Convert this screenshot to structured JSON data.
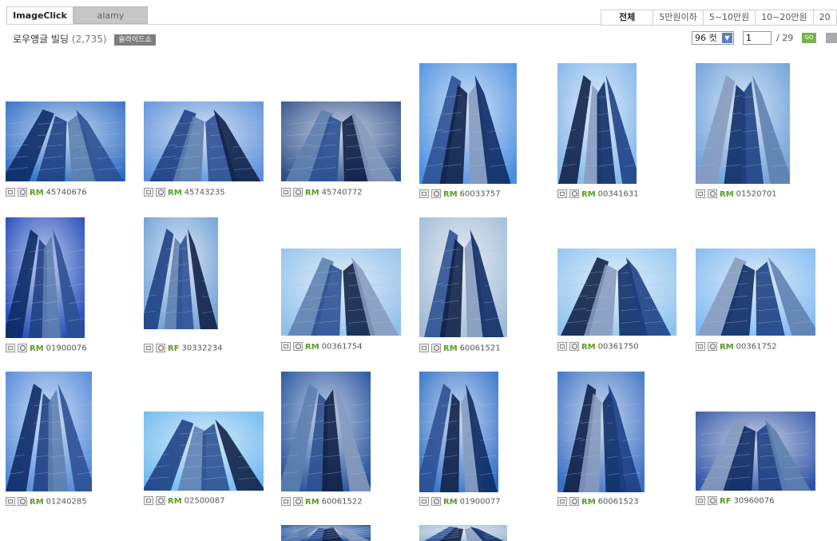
{
  "tabs": [
    {
      "label": "ImageClick"
    },
    {
      "label": "alamy"
    }
  ],
  "filters": [
    "전체",
    "5만원이하",
    "5~10만원",
    "10~20만원",
    "20"
  ],
  "title": {
    "text": "로우앵글 빌딩",
    "count": "(2,735)",
    "slideshow": "슬라이드쇼"
  },
  "pager": {
    "per_page": "96 컷",
    "page": "1",
    "total": "/ 29",
    "go": "GO"
  },
  "items": [
    {
      "license": "RM",
      "code": "45740676"
    },
    {
      "license": "RM",
      "code": "45743235"
    },
    {
      "license": "RM",
      "code": "45740772"
    },
    {
      "license": "RM",
      "code": "60033757"
    },
    {
      "license": "RM",
      "code": "00341631"
    },
    {
      "license": "RM",
      "code": "01520701"
    },
    {
      "license": "RM",
      "code": "01900076"
    },
    {
      "license": "RF",
      "code": "30332234"
    },
    {
      "license": "RM",
      "code": "00361754"
    },
    {
      "license": "RM",
      "code": "60061521"
    },
    {
      "license": "RM",
      "code": "00361750"
    },
    {
      "license": "RM",
      "code": "00361752"
    },
    {
      "license": "RM",
      "code": "01240285"
    },
    {
      "license": "RM",
      "code": "02500087"
    },
    {
      "license": "RM",
      "code": "60061522"
    },
    {
      "license": "RM",
      "code": "01900077"
    },
    {
      "license": "RM",
      "code": "60061523"
    },
    {
      "license": "RF",
      "code": "30960076"
    },
    {
      "license": "",
      "code": ""
    },
    {
      "license": "",
      "code": ""
    }
  ],
  "colors": {
    "license_green": "#5b9b2a",
    "sky": "#3d78c9",
    "deep": "#10337a"
  }
}
